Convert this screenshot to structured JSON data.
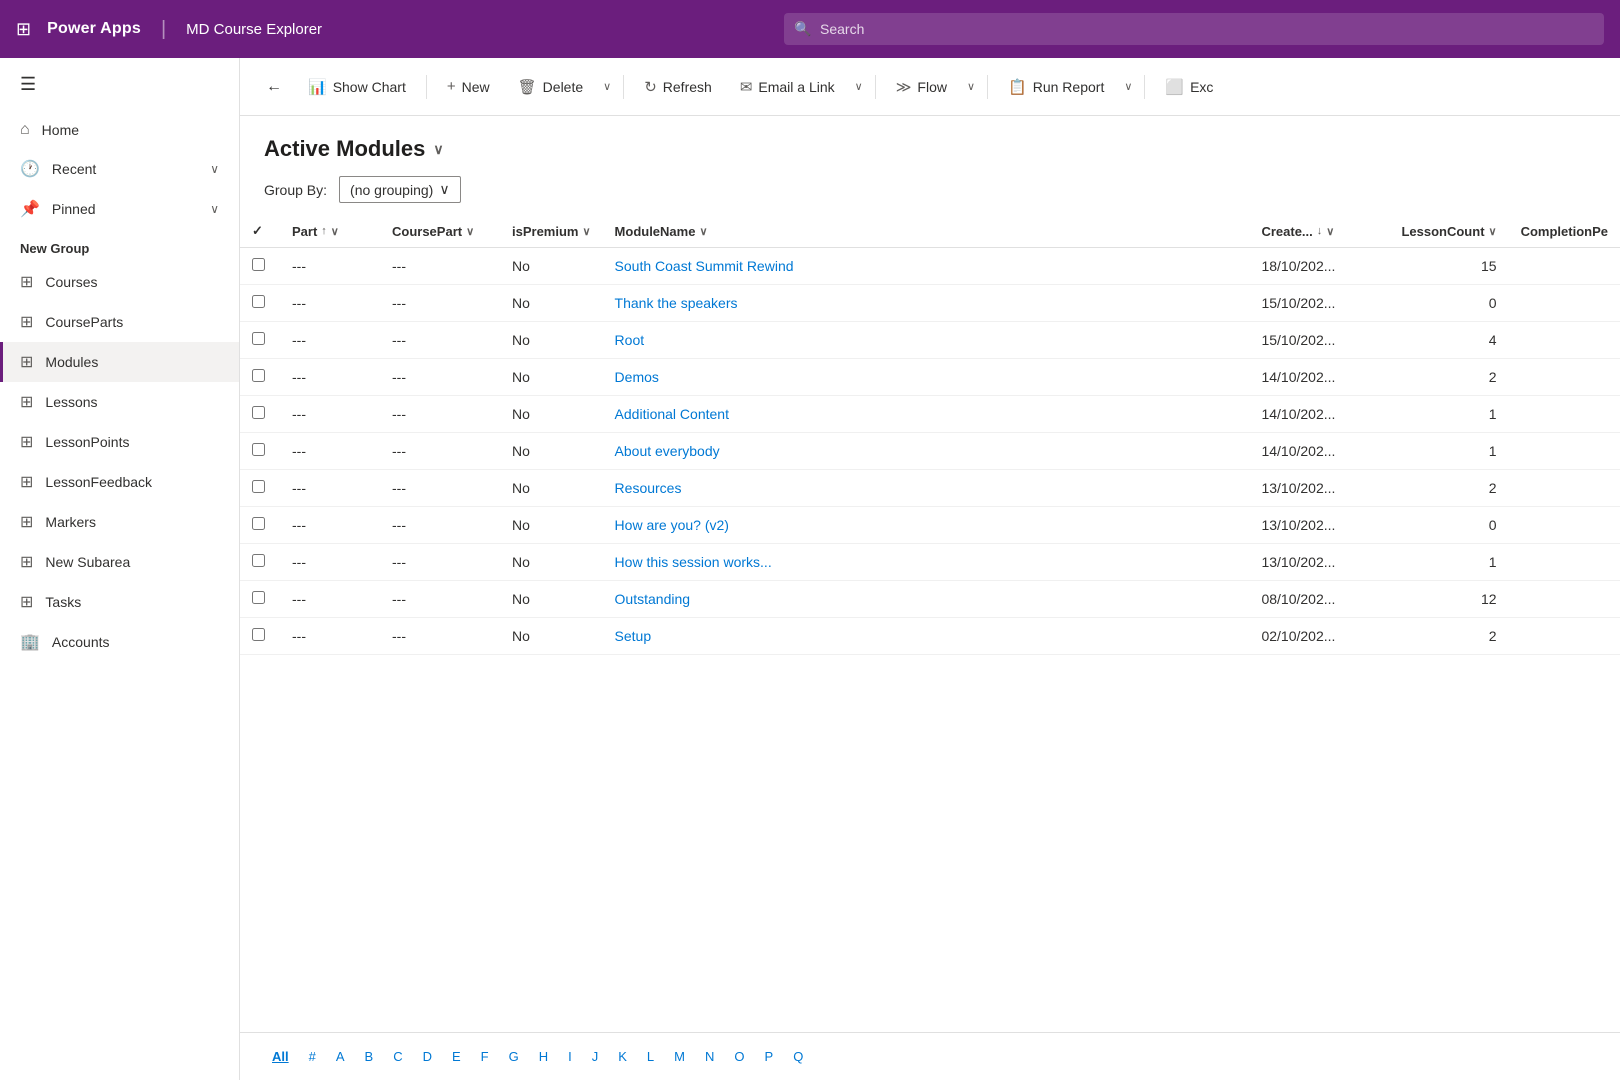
{
  "topNav": {
    "waffle": "⊞",
    "logo": "Power Apps",
    "divider": "|",
    "appName": "MD Course Explorer",
    "searchPlaceholder": "Search"
  },
  "sidebar": {
    "toggleIcon": "☰",
    "items": [
      {
        "id": "home",
        "icon": "⌂",
        "label": "Home",
        "hasChevron": false
      },
      {
        "id": "recent",
        "icon": "🕐",
        "label": "Recent",
        "hasChevron": true
      },
      {
        "id": "pinned",
        "icon": "📌",
        "label": "Pinned",
        "hasChevron": true
      }
    ],
    "sectionLabel": "New Group",
    "navItems": [
      {
        "id": "courses",
        "icon": "🎓",
        "label": "Courses",
        "active": false
      },
      {
        "id": "courseparts",
        "icon": "🧩",
        "label": "CourseParts",
        "active": false
      },
      {
        "id": "modules",
        "icon": "🧩",
        "label": "Modules",
        "active": true
      },
      {
        "id": "lessons",
        "icon": "🧩",
        "label": "Lessons",
        "active": false
      },
      {
        "id": "lessonpoints",
        "icon": "🧩",
        "label": "LessonPoints",
        "active": false
      },
      {
        "id": "lessonfeedback",
        "icon": "🧩",
        "label": "LessonFeedback",
        "active": false
      },
      {
        "id": "markers",
        "icon": "🧩",
        "label": "Markers",
        "active": false
      },
      {
        "id": "newsubarea",
        "icon": "⊞",
        "label": "New Subarea",
        "active": false
      },
      {
        "id": "tasks",
        "icon": "🧩",
        "label": "Tasks",
        "active": false
      },
      {
        "id": "accounts",
        "icon": "🏢",
        "label": "Accounts",
        "active": false
      }
    ]
  },
  "toolbar": {
    "backIcon": "←",
    "showChartIcon": "📊",
    "showChartLabel": "Show Chart",
    "newIcon": "+",
    "newLabel": "New",
    "deleteIcon": "🗑",
    "deleteLabel": "Delete",
    "refreshIcon": "↻",
    "refreshLabel": "Refresh",
    "emailIcon": "✉",
    "emailLabel": "Email a Link",
    "flowIcon": "≫",
    "flowLabel": "Flow",
    "runReportIcon": "📋",
    "runReportLabel": "Run Report",
    "excelIcon": "⬜",
    "excelLabel": "Exc"
  },
  "pageHeader": {
    "title": "Active Modules",
    "titleChevron": "∨",
    "groupByLabel": "Group By:",
    "groupByValue": "(no grouping)",
    "groupByChevron": "∨"
  },
  "tableColumns": [
    {
      "id": "check",
      "label": "✓"
    },
    {
      "id": "part",
      "label": "Part",
      "sortable": true,
      "filterable": true
    },
    {
      "id": "coursepart",
      "label": "CoursePart",
      "sortable": false,
      "filterable": true
    },
    {
      "id": "ispremium",
      "label": "isPremium",
      "sortable": false,
      "filterable": true
    },
    {
      "id": "modulename",
      "label": "ModuleName",
      "sortable": false,
      "filterable": true
    },
    {
      "id": "created",
      "label": "Create...",
      "sortable": true,
      "filterable": true
    },
    {
      "id": "lessoncount",
      "label": "LessonCount",
      "sortable": false,
      "filterable": true
    },
    {
      "id": "completionpe",
      "label": "CompletionPe",
      "sortable": false,
      "filterable": false
    }
  ],
  "tableRows": [
    {
      "part": "---",
      "coursepart": "---",
      "ispremium": "No",
      "modulename": "South Coast Summit Rewind",
      "created": "18/10/202...",
      "lessoncount": 15,
      "completionpe": ""
    },
    {
      "part": "---",
      "coursepart": "---",
      "ispremium": "No",
      "modulename": "Thank the speakers",
      "created": "15/10/202...",
      "lessoncount": 0,
      "completionpe": ""
    },
    {
      "part": "---",
      "coursepart": "---",
      "ispremium": "No",
      "modulename": "Root",
      "created": "15/10/202...",
      "lessoncount": 4,
      "completionpe": ""
    },
    {
      "part": "---",
      "coursepart": "---",
      "ispremium": "No",
      "modulename": "Demos",
      "created": "14/10/202...",
      "lessoncount": 2,
      "completionpe": ""
    },
    {
      "part": "---",
      "coursepart": "---",
      "ispremium": "No",
      "modulename": "Additional Content",
      "created": "14/10/202...",
      "lessoncount": 1,
      "completionpe": ""
    },
    {
      "part": "---",
      "coursepart": "---",
      "ispremium": "No",
      "modulename": "About everybody",
      "created": "14/10/202...",
      "lessoncount": 1,
      "completionpe": ""
    },
    {
      "part": "---",
      "coursepart": "---",
      "ispremium": "No",
      "modulename": "Resources",
      "created": "13/10/202...",
      "lessoncount": 2,
      "completionpe": ""
    },
    {
      "part": "---",
      "coursepart": "---",
      "ispremium": "No",
      "modulename": "How are you? (v2)",
      "created": "13/10/202...",
      "lessoncount": 0,
      "completionpe": ""
    },
    {
      "part": "---",
      "coursepart": "---",
      "ispremium": "No",
      "modulename": "How this session works...",
      "created": "13/10/202...",
      "lessoncount": 1,
      "completionpe": ""
    },
    {
      "part": "---",
      "coursepart": "---",
      "ispremium": "No",
      "modulename": "Outstanding",
      "created": "08/10/202...",
      "lessoncount": 12,
      "completionpe": ""
    },
    {
      "part": "---",
      "coursepart": "---",
      "ispremium": "No",
      "modulename": "Setup",
      "created": "02/10/202...",
      "lessoncount": 2,
      "completionpe": ""
    }
  ],
  "footerNav": {
    "letters": [
      "All",
      "#",
      "A",
      "B",
      "C",
      "D",
      "E",
      "F",
      "G",
      "H",
      "I",
      "J",
      "K",
      "L",
      "M",
      "N",
      "O",
      "P",
      "Q"
    ],
    "activeLetter": "All"
  }
}
